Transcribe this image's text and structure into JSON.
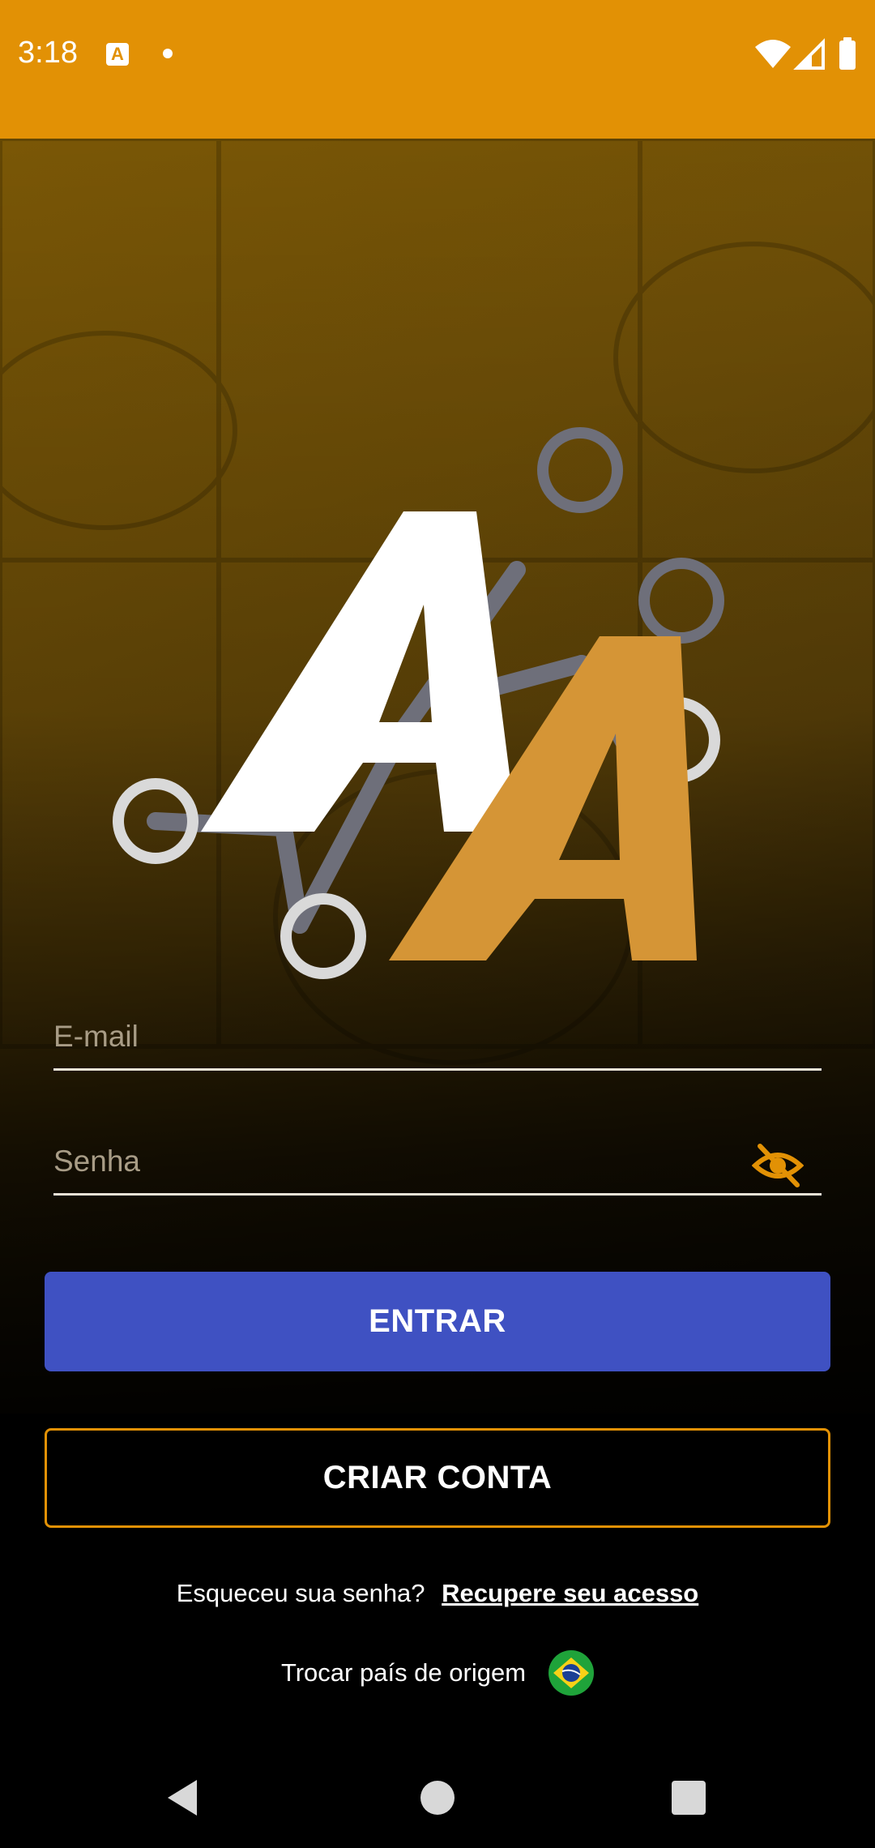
{
  "status_bar": {
    "time": "3:18",
    "notification_icon": "app-a-icon",
    "indicators": [
      "wifi-icon",
      "signal-icon",
      "battery-icon"
    ],
    "color": "#E29105"
  },
  "login": {
    "email_placeholder": "E-mail",
    "password_placeholder": "Senha",
    "enter_button": "ENTRAR",
    "create_account_button": "CRIAR CONTA",
    "forgot_text": "Esqueceu sua senha?",
    "recover_link": "Recupere seu acesso",
    "change_country_text": "Trocar país de origem",
    "country_flag": "brazil-flag-icon"
  },
  "colors": {
    "brand_orange": "#E29105",
    "logo_orange": "#D59536",
    "button_blue": "#3F51C2"
  },
  "nav_bar": {
    "buttons": [
      "back-icon",
      "home-icon",
      "recents-icon"
    ]
  }
}
